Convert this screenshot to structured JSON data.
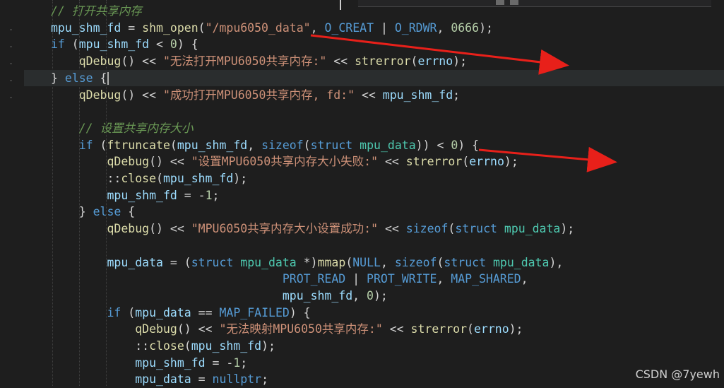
{
  "editor": {
    "lines": [
      {
        "tokens": [
          [
            "cm",
            "// 打开共享内存"
          ]
        ]
      },
      {
        "tokens": [
          [
            "var",
            "mpu_shm_fd"
          ],
          [
            "def",
            " = "
          ],
          [
            "fn",
            "shm_open"
          ],
          [
            "def",
            "("
          ],
          [
            "st",
            "\"/mpu6050_data\""
          ],
          [
            "def",
            ", "
          ],
          [
            "mac",
            "O_CREAT"
          ],
          [
            "def",
            " | "
          ],
          [
            "mac",
            "O_RDWR"
          ],
          [
            "def",
            ", "
          ],
          [
            "num",
            "0666"
          ],
          [
            "def",
            ");"
          ]
        ]
      },
      {
        "tokens": [
          [
            "kw",
            "if"
          ],
          [
            "def",
            " ("
          ],
          [
            "var",
            "mpu_shm_fd"
          ],
          [
            "def",
            " < "
          ],
          [
            "num",
            "0"
          ],
          [
            "def",
            ") {"
          ]
        ]
      },
      {
        "tokens": [
          [
            "def",
            "    "
          ],
          [
            "fn",
            "qDebug"
          ],
          [
            "def",
            "() << "
          ],
          [
            "st",
            "\"无法打开MPU6050共享内存:\""
          ],
          [
            "def",
            " << "
          ],
          [
            "fn",
            "strerror"
          ],
          [
            "def",
            "("
          ],
          [
            "var",
            "errno"
          ],
          [
            "def",
            ");"
          ]
        ]
      },
      {
        "tokens": [
          [
            "def",
            "} "
          ],
          [
            "kw",
            "else"
          ],
          [
            "def",
            " {"
          ]
        ]
      },
      {
        "tokens": [
          [
            "def",
            "    "
          ],
          [
            "fn",
            "qDebug"
          ],
          [
            "def",
            "() << "
          ],
          [
            "st",
            "\"成功打开MPU6050共享内存, fd:\""
          ],
          [
            "def",
            " << "
          ],
          [
            "var",
            "mpu_shm_fd"
          ],
          [
            "def",
            ";"
          ]
        ]
      },
      {
        "tokens": []
      },
      {
        "tokens": [
          [
            "def",
            "    "
          ],
          [
            "cm",
            "// 设置共享内存大小"
          ]
        ]
      },
      {
        "tokens": [
          [
            "def",
            "    "
          ],
          [
            "kw",
            "if"
          ],
          [
            "def",
            " ("
          ],
          [
            "fn",
            "ftruncate"
          ],
          [
            "def",
            "("
          ],
          [
            "var",
            "mpu_shm_fd"
          ],
          [
            "def",
            ", "
          ],
          [
            "kw",
            "sizeof"
          ],
          [
            "def",
            "("
          ],
          [
            "kw",
            "struct"
          ],
          [
            "def",
            " "
          ],
          [
            "ty",
            "mpu_data"
          ],
          [
            "def",
            ")) < "
          ],
          [
            "num",
            "0"
          ],
          [
            "def",
            ") {"
          ]
        ]
      },
      {
        "tokens": [
          [
            "def",
            "        "
          ],
          [
            "fn",
            "qDebug"
          ],
          [
            "def",
            "() << "
          ],
          [
            "st",
            "\"设置MPU6050共享内存大小失败:\""
          ],
          [
            "def",
            " << "
          ],
          [
            "fn",
            "strerror"
          ],
          [
            "def",
            "("
          ],
          [
            "var",
            "errno"
          ],
          [
            "def",
            ");"
          ]
        ]
      },
      {
        "tokens": [
          [
            "def",
            "        ::"
          ],
          [
            "fn",
            "close"
          ],
          [
            "def",
            "("
          ],
          [
            "var",
            "mpu_shm_fd"
          ],
          [
            "def",
            ");"
          ]
        ]
      },
      {
        "tokens": [
          [
            "def",
            "        "
          ],
          [
            "var",
            "mpu_shm_fd"
          ],
          [
            "def",
            " = -"
          ],
          [
            "num",
            "1"
          ],
          [
            "def",
            ";"
          ]
        ]
      },
      {
        "tokens": [
          [
            "def",
            "    } "
          ],
          [
            "kw",
            "else"
          ],
          [
            "def",
            " {"
          ]
        ]
      },
      {
        "tokens": [
          [
            "def",
            "        "
          ],
          [
            "fn",
            "qDebug"
          ],
          [
            "def",
            "() << "
          ],
          [
            "st",
            "\"MPU6050共享内存大小设置成功:\""
          ],
          [
            "def",
            " << "
          ],
          [
            "kw",
            "sizeof"
          ],
          [
            "def",
            "("
          ],
          [
            "kw",
            "struct"
          ],
          [
            "def",
            " "
          ],
          [
            "ty",
            "mpu_data"
          ],
          [
            "def",
            ");"
          ]
        ]
      },
      {
        "tokens": []
      },
      {
        "tokens": [
          [
            "def",
            "        "
          ],
          [
            "var",
            "mpu_data"
          ],
          [
            "def",
            " = ("
          ],
          [
            "kw",
            "struct"
          ],
          [
            "def",
            " "
          ],
          [
            "ty",
            "mpu_data"
          ],
          [
            "def",
            " *)"
          ],
          [
            "fn",
            "mmap"
          ],
          [
            "def",
            "("
          ],
          [
            "mac",
            "NULL"
          ],
          [
            "def",
            ", "
          ],
          [
            "kw",
            "sizeof"
          ],
          [
            "def",
            "("
          ],
          [
            "kw",
            "struct"
          ],
          [
            "def",
            " "
          ],
          [
            "ty",
            "mpu_data"
          ],
          [
            "def",
            "),"
          ]
        ]
      },
      {
        "tokens": [
          [
            "def",
            "                                 "
          ],
          [
            "mac",
            "PROT_READ"
          ],
          [
            "def",
            " | "
          ],
          [
            "mac",
            "PROT_WRITE"
          ],
          [
            "def",
            ", "
          ],
          [
            "mac",
            "MAP_SHARED"
          ],
          [
            "def",
            ","
          ]
        ]
      },
      {
        "tokens": [
          [
            "def",
            "                                 "
          ],
          [
            "var",
            "mpu_shm_fd"
          ],
          [
            "def",
            ", "
          ],
          [
            "num",
            "0"
          ],
          [
            "def",
            ");"
          ]
        ]
      },
      {
        "tokens": [
          [
            "def",
            "        "
          ],
          [
            "kw",
            "if"
          ],
          [
            "def",
            " ("
          ],
          [
            "var",
            "mpu_data"
          ],
          [
            "def",
            " == "
          ],
          [
            "mac",
            "MAP_FAILED"
          ],
          [
            "def",
            ") {"
          ]
        ]
      },
      {
        "tokens": [
          [
            "def",
            "            "
          ],
          [
            "fn",
            "qDebug"
          ],
          [
            "def",
            "() << "
          ],
          [
            "st",
            "\"无法映射MPU6050共享内存:\""
          ],
          [
            "def",
            " << "
          ],
          [
            "fn",
            "strerror"
          ],
          [
            "def",
            "("
          ],
          [
            "var",
            "errno"
          ],
          [
            "def",
            ");"
          ]
        ]
      },
      {
        "tokens": [
          [
            "def",
            "            ::"
          ],
          [
            "fn",
            "close"
          ],
          [
            "def",
            "("
          ],
          [
            "var",
            "mpu_shm_fd"
          ],
          [
            "def",
            ");"
          ]
        ]
      },
      {
        "tokens": [
          [
            "def",
            "            "
          ],
          [
            "var",
            "mpu_shm_fd"
          ],
          [
            "def",
            " = -"
          ],
          [
            "num",
            "1"
          ],
          [
            "def",
            ";"
          ]
        ]
      },
      {
        "tokens": [
          [
            "def",
            "            "
          ],
          [
            "var",
            "mpu_data"
          ],
          [
            "def",
            " = "
          ],
          [
            "kw",
            "nullptr"
          ],
          [
            "def",
            ";"
          ]
        ]
      }
    ]
  },
  "watermark": "CSDN @7yewh",
  "colors": {
    "background": "#1e1e1e",
    "arrow": "#e8201a"
  }
}
